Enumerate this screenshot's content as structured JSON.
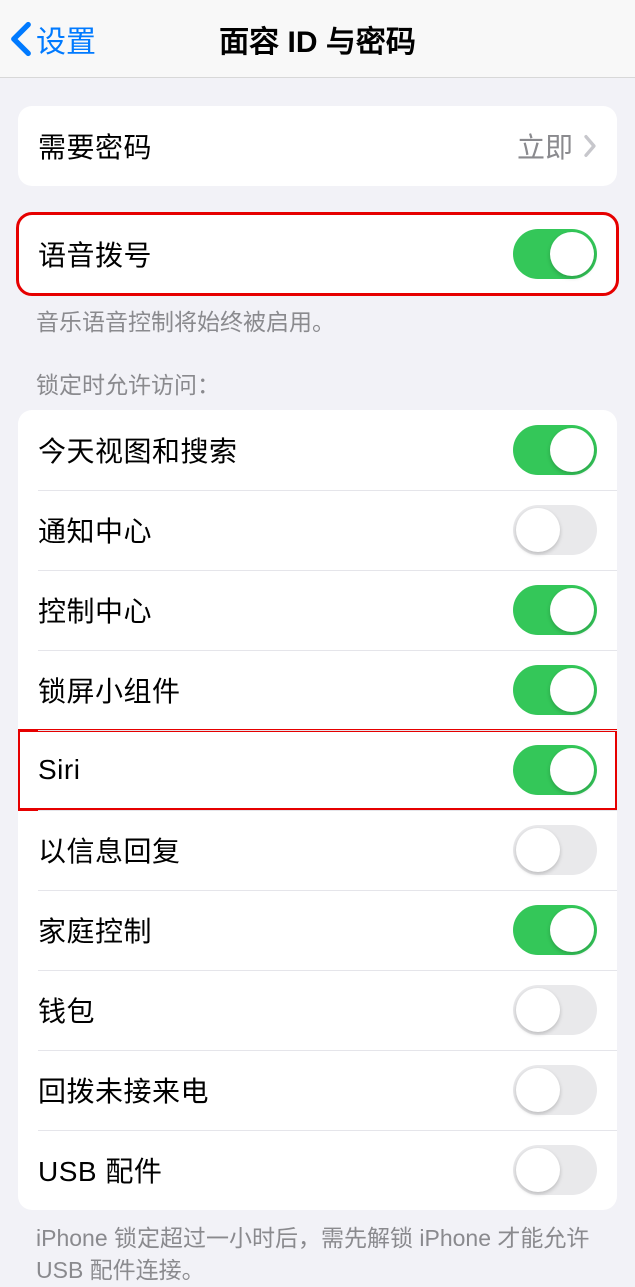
{
  "nav": {
    "back_label": "设置",
    "title": "面容 ID 与密码"
  },
  "require_passcode": {
    "label": "需要密码",
    "value": "立即"
  },
  "voice_dial": {
    "label": "语音拨号",
    "on": true,
    "footer": "音乐语音控制将始终被启用。"
  },
  "lock_access": {
    "header": "锁定时允许访问：",
    "items": [
      {
        "label": "今天视图和搜索",
        "on": true
      },
      {
        "label": "通知中心",
        "on": false
      },
      {
        "label": "控制中心",
        "on": true
      },
      {
        "label": "锁屏小组件",
        "on": true
      },
      {
        "label": "Siri",
        "on": true
      },
      {
        "label": "以信息回复",
        "on": false
      },
      {
        "label": "家庭控制",
        "on": true
      },
      {
        "label": "钱包",
        "on": false
      },
      {
        "label": "回拨未接来电",
        "on": false
      },
      {
        "label": "USB 配件",
        "on": false
      }
    ],
    "footer": "iPhone 锁定超过一小时后，需先解锁 iPhone 才能允许 USB 配件连接。"
  }
}
